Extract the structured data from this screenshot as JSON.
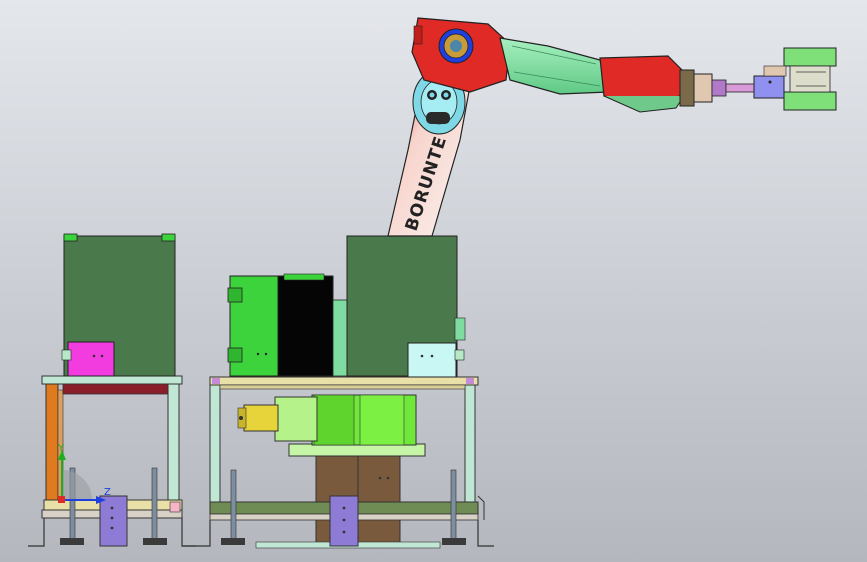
{
  "robot": {
    "brand_text": "BORUNTE"
  },
  "triad": {
    "y_label": "Y",
    "z_label": "Z"
  },
  "colors": {
    "background_top": "#e4e7ec",
    "background_bottom": "#b4b7bd",
    "robot_red": "#e02a25",
    "robot_white": "#f6ece8",
    "arm_green": "#7fdca0",
    "cabinet_green": "#4a7a4b",
    "bright_green": "#3cd33c",
    "frame_tan": "#e3d9a6",
    "magenta_box": "#f23ce0",
    "pedestal_brown": "#7a5a3c",
    "purple_plate": "#8e7bd6"
  }
}
